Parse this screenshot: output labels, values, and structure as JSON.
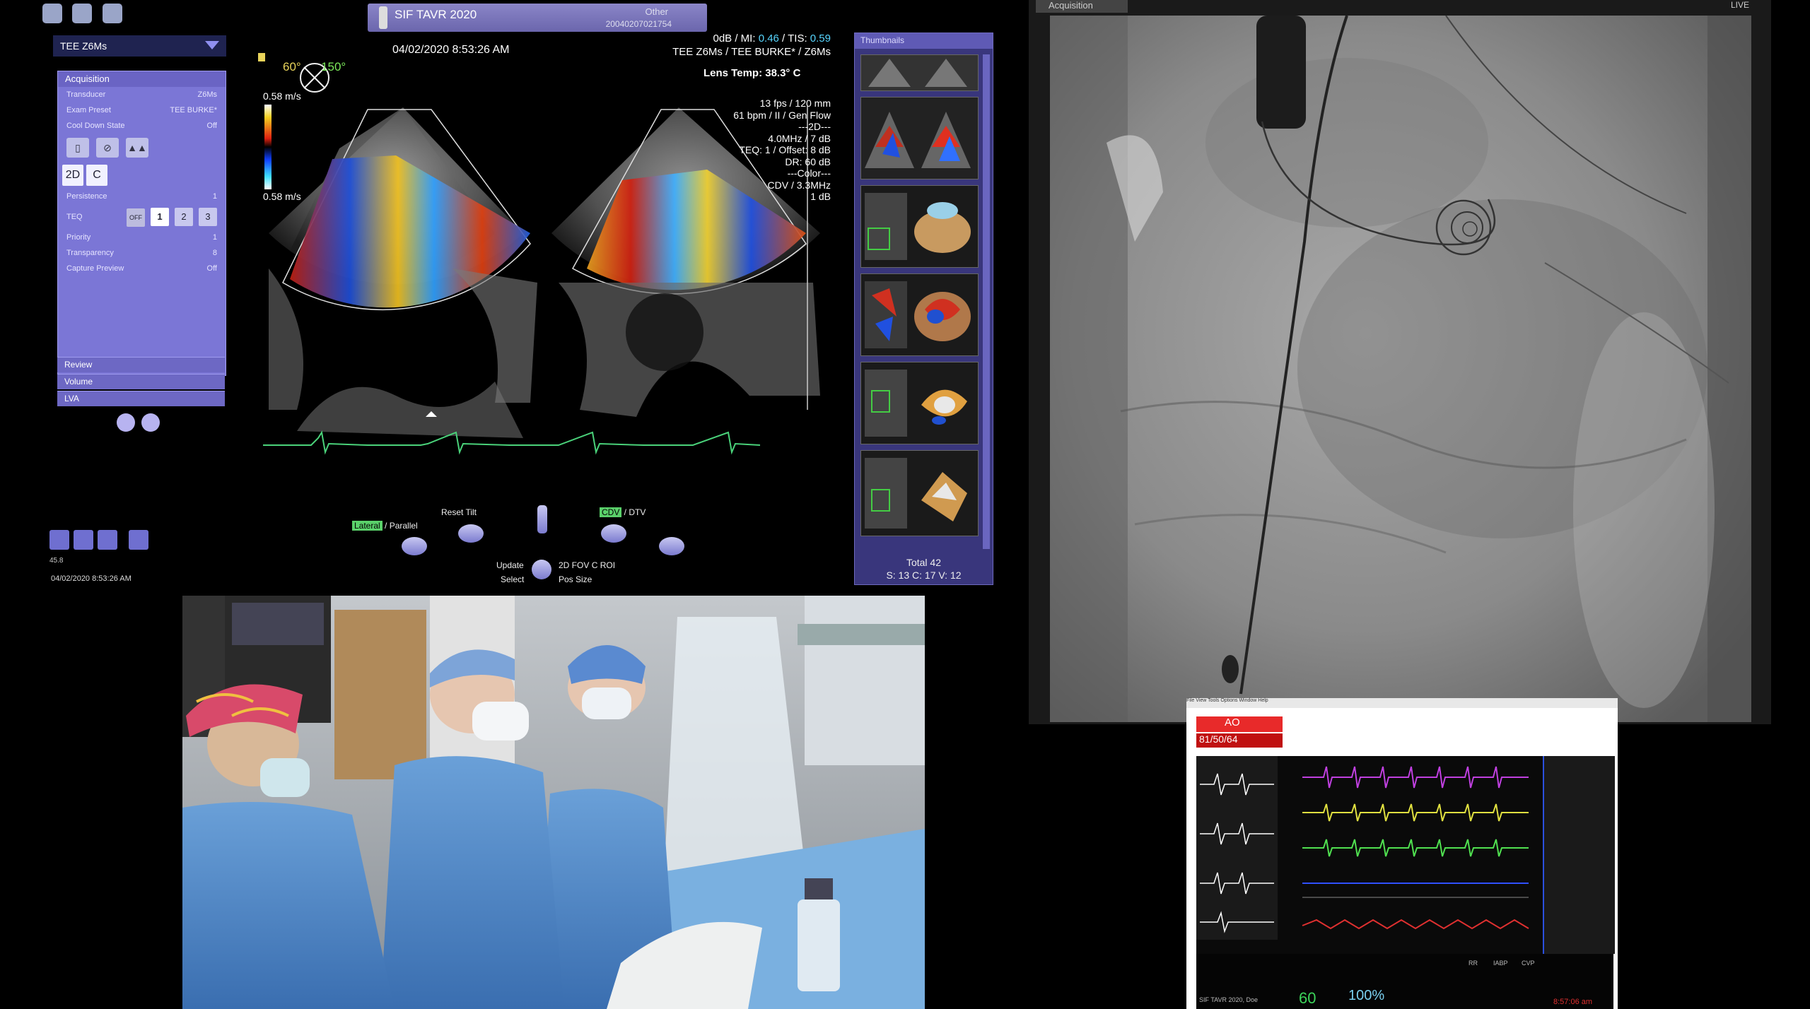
{
  "patient_bar": {
    "name": "SIF TAVR 2020",
    "category": "Other",
    "id": "20040207021754"
  },
  "left_panel": {
    "probe": "TEE Z6Ms",
    "acquisition": "Acquisition",
    "rows": [
      {
        "label": "Transducer",
        "value": "Z6Ms"
      },
      {
        "label": "Exam Preset",
        "value": "TEE BURKE*"
      },
      {
        "label": "Cool Down State",
        "value": "Off"
      }
    ],
    "mode_2d": "2D",
    "mode_c": "C",
    "persistence": {
      "label": "Persistence",
      "value": "1"
    },
    "teq": {
      "label": "TEQ",
      "off": "OFF",
      "options": [
        "1",
        "2",
        "3"
      ]
    },
    "priority": {
      "label": "Priority",
      "value": "1"
    },
    "transparency": {
      "label": "Transparency",
      "value": "8"
    },
    "capture_preview": {
      "label": "Capture Preview",
      "value": "Off"
    },
    "review": "Review",
    "volume": "Volume",
    "lva": "LVA",
    "fps_tag": "45.8",
    "datetime": "04/02/2020 8:53:26 AM"
  },
  "echo": {
    "timestamp": "04/02/2020 8:53:26 AM",
    "angle1": "60°",
    "angle2": "150°",
    "vel_top": "0.58 m/s",
    "vel_bottom": "0.58 m/s",
    "header_line1_a": "0dB / MI: ",
    "header_mi": "0.46",
    "header_line1_b": " / TIS: ",
    "header_tis": "0.59",
    "header_line2": "TEE Z6Ms / TEE BURKE* / Z6Ms",
    "lens_temp": "Lens Temp: 38.3° C",
    "params": [
      "13 fps / 120 mm",
      "61 bpm / II / Gen Flow",
      "---2D---",
      "4.0MHz / 7 dB",
      "TEQ: 1 / Offset: 8 dB",
      "DR: 60 dB",
      "---Color---",
      "CDV / 3.3MHz",
      "1 dB"
    ]
  },
  "controls": {
    "lateral": "Lateral",
    "parallel": " / Parallel",
    "reset_tilt": "Reset Tilt",
    "cdv": "CDV",
    "dtv": " / DTV",
    "update": "Update",
    "select": "Select",
    "fov": "2D FOV",
    "roi": "C ROI",
    "pos_size": "Pos Size"
  },
  "thumbnails": {
    "header": "Thumbnails",
    "total": "Total   42",
    "breakdown": "S: 13 C: 17 V: 12"
  },
  "fluoro": {
    "tab": "Acquisition",
    "live": "LIVE"
  },
  "monitor": {
    "title_bar": "File  View  Tools  Options  Window  Help",
    "ao_label": "AO",
    "bp": "81/50/64",
    "footer_label": "SIF TAVR 2020, Doe",
    "hr": "60",
    "spo2": "100%",
    "cols": [
      "RR",
      "IABP",
      "CVP"
    ],
    "time": "8:57:06 am"
  },
  "colors": {
    "panel": "#7b76d6",
    "accent_green": "#5ad06a",
    "mi_value": "#57d6ff",
    "ao_red": "#e82a2a"
  }
}
